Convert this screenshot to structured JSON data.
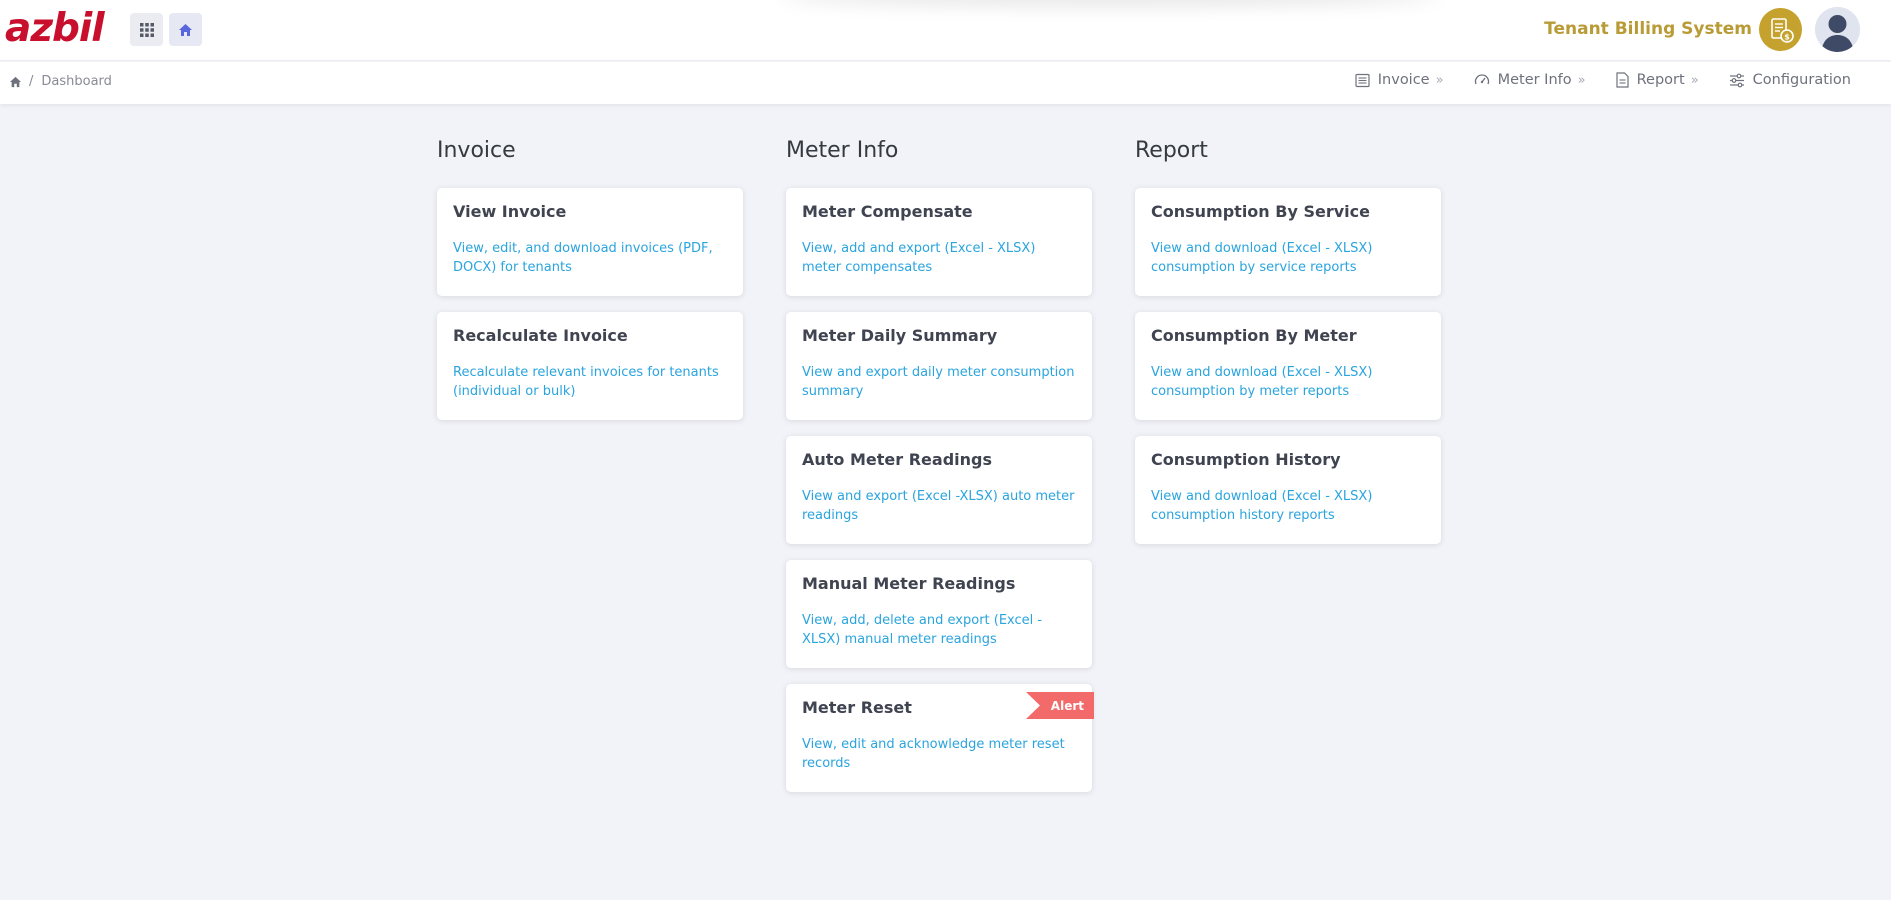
{
  "header": {
    "logo_text": "azbil",
    "system_title": "Tenant Billing System",
    "colors": {
      "logo": "#c8102e",
      "brand": "#b99b36",
      "link": "#2aa4de",
      "alert": "#f36a6a"
    }
  },
  "breadcrumb": {
    "home_icon": "home-icon",
    "separator": "/",
    "current": "Dashboard"
  },
  "topnav": [
    {
      "label": "Invoice",
      "icon": "list-icon",
      "suffix": "»"
    },
    {
      "label": "Meter Info",
      "icon": "gauge-icon",
      "suffix": "»"
    },
    {
      "label": "Report",
      "icon": "document-icon",
      "suffix": "»"
    },
    {
      "label": "Configuration",
      "icon": "sliders-icon",
      "suffix": ""
    }
  ],
  "columns": [
    {
      "title": "Invoice",
      "cards": [
        {
          "title": "View Invoice",
          "desc": "View, edit, and download invoices (PDF, DOCX) for tenants"
        },
        {
          "title": "Recalculate Invoice",
          "desc": "Recalculate relevant invoices for tenants (individual or bulk)"
        }
      ]
    },
    {
      "title": "Meter Info",
      "cards": [
        {
          "title": "Meter Compensate",
          "desc": "View, add and export (Excel - XLSX) meter compensates"
        },
        {
          "title": "Meter Daily Summary",
          "desc": "View and export daily meter consumption summary"
        },
        {
          "title": "Auto Meter Readings",
          "desc": "View and export (Excel -XLSX) auto meter readings"
        },
        {
          "title": "Manual Meter Readings",
          "desc": "View, add, delete and export (Excel -XLSX) manual meter readings"
        },
        {
          "title": "Meter Reset",
          "desc": "View, edit and acknowledge meter reset records",
          "badge": "Alert"
        }
      ]
    },
    {
      "title": "Report",
      "cards": [
        {
          "title": "Consumption By Service",
          "desc": "View and download (Excel - XLSX) consumption by service reports"
        },
        {
          "title": "Consumption By Meter",
          "desc": "View and download (Excel - XLSX) consumption by meter reports"
        },
        {
          "title": "Consumption History",
          "desc": "View and download (Excel - XLSX) consumption history reports"
        }
      ]
    }
  ]
}
